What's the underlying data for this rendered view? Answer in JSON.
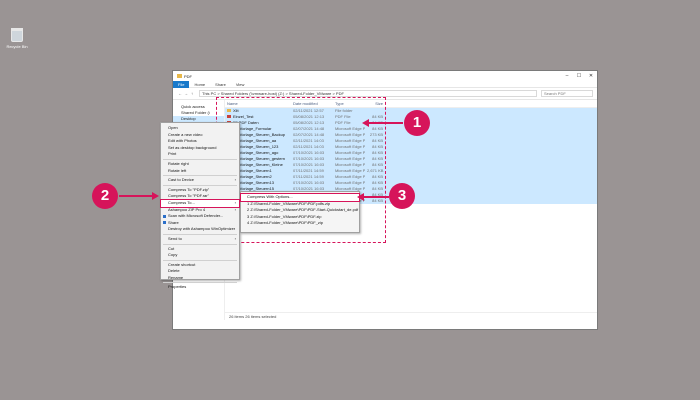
{
  "desktop": {
    "recycle_bin_label": "Recycle Bin"
  },
  "window": {
    "title": "PDF",
    "ribbon_tabs": [
      "File",
      "Home",
      "Share",
      "View"
    ],
    "address_path": "This PC  >  Shared Folders (\\\\vmware-host) (Z:)  >  Shared-Folder_VMware  >  PDF",
    "search_placeholder": "Search PDF",
    "nav_items": [
      "Quick access",
      "Shared Folder (\\",
      "Desktop"
    ],
    "columns": {
      "name": "Name",
      "date": "Date modified",
      "type": "Type",
      "size": "Size"
    },
    "files": [
      {
        "name": "Xlit",
        "date": "02/11/2021 12:57",
        "type": "File folder",
        "size": ""
      },
      {
        "name": "Einzel_Test",
        "date": "05/08/2021 12:13",
        "type": "PDF File",
        "size": "84 KB"
      },
      {
        "name": "5F PDF Daten",
        "date": "05/08/2021 12:13",
        "type": "PDF File",
        "size": "84 KB"
      },
      {
        "name": "CV-Vorlage_Formular",
        "date": "02/07/2021 14:48",
        "type": "Microsoft Edge P...",
        "size": "84 KB"
      },
      {
        "name": "CV-Vorlage_Steuern_Backup",
        "date": "02/07/2021 14:48",
        "type": "Microsoft Edge P...",
        "size": "273 KB"
      },
      {
        "name": "CV-Vorlage_Steuern_aa",
        "date": "02/11/2021 14:03",
        "type": "Microsoft Edge P...",
        "size": "84 KB"
      },
      {
        "name": "CV-Vorlage_Steuern_123",
        "date": "02/11/2021 14:03",
        "type": "Microsoft Edge P...",
        "size": "84 KB"
      },
      {
        "name": "CV-Vorlage_Steuern_ago",
        "date": "07/10/2021 16:03",
        "type": "Microsoft Edge P...",
        "size": "84 KB"
      },
      {
        "name": "CV-Vorlage_Steuern_gestern",
        "date": "07/10/2021 16:03",
        "type": "Microsoft Edge P...",
        "size": "84 KB"
      },
      {
        "name": "CV-Vorlage_Steuern_Kleine",
        "date": "07/10/2021 16:03",
        "type": "Microsoft Edge P...",
        "size": "84 KB"
      },
      {
        "name": "CV-Vorlage_Steuern1",
        "date": "07/11/2021 14:59",
        "type": "Microsoft Edge P...",
        "size": "2,671 KB"
      },
      {
        "name": "CV-Vorlage_Steuern2",
        "date": "07/11/2021 14:59",
        "type": "Microsoft Edge P...",
        "size": "84 KB"
      },
      {
        "name": "CV-Vorlage_Steuern13",
        "date": "07/10/2021 16:03",
        "type": "Microsoft Edge P...",
        "size": "84 KB"
      },
      {
        "name": "CV-Vorlage_Steuern15",
        "date": "07/10/2021 16:03",
        "type": "Microsoft Edge P...",
        "size": "84 KB"
      },
      {
        "name": "Kfz_Mess.zip",
        "date": "03/11/2021 12:00",
        "type": "ZIP File",
        "size": "84 KB"
      },
      {
        "name": "Microsoft Edge",
        "date": "07/10/2021 16:03",
        "type": "Microsoft Edge P...",
        "size": "84 KB"
      }
    ],
    "status": "26 items    26 items selected"
  },
  "context_menu": {
    "items": [
      {
        "label": "Open",
        "arrow": false,
        "sep_after": false
      },
      {
        "label": "Create a new video",
        "arrow": false,
        "sep_after": false
      },
      {
        "label": "Edit with Photos",
        "arrow": false,
        "sep_after": false
      },
      {
        "label": "Set as desktop background",
        "arrow": false,
        "sep_after": false
      },
      {
        "label": "Print",
        "arrow": false,
        "sep_after": true
      },
      {
        "label": "Rotate right",
        "arrow": false,
        "sep_after": false
      },
      {
        "label": "Rotate left",
        "arrow": false,
        "sep_after": true
      },
      {
        "label": "Cast to Device",
        "arrow": true,
        "sep_after": true
      },
      {
        "label": "Compress To \"PDF.zip\"",
        "arrow": false,
        "sep_after": false
      },
      {
        "label": "Compress To \"PDF.rar\"",
        "arrow": false,
        "sep_after": false
      },
      {
        "label": "Compress To...",
        "arrow": true,
        "sep_after": false,
        "highlight": true
      },
      {
        "label": "Ashampoo ZIP Pro 4",
        "arrow": true,
        "sep_after": false
      },
      {
        "label": "Scan with Microsoft Defender...",
        "arrow": false,
        "sep_after": false,
        "icon": true
      },
      {
        "label": "Share",
        "arrow": false,
        "sep_after": false,
        "icon": true
      },
      {
        "label": "Destroy with Ashampoo WinOptimizer",
        "arrow": false,
        "sep_after": true
      },
      {
        "label": "Send to",
        "arrow": true,
        "sep_after": true
      },
      {
        "label": "Cut",
        "arrow": false,
        "sep_after": false
      },
      {
        "label": "Copy",
        "arrow": false,
        "sep_after": true
      },
      {
        "label": "Create shortcut",
        "arrow": false,
        "sep_after": false
      },
      {
        "label": "Delete",
        "arrow": false,
        "sep_after": false
      },
      {
        "label": "Rename",
        "arrow": false,
        "sep_after": true
      },
      {
        "label": "Properties",
        "arrow": false,
        "sep_after": false
      }
    ]
  },
  "submenu": {
    "items": [
      {
        "label": "Compress With Options...",
        "highlight": true
      },
      {
        "label": "1 Z:\\Shared-Folder_VMware\\PDF\\PDF.pdfs.zip",
        "highlight": false
      },
      {
        "label": "2 Z:\\Shared-Folder_VMware\\PDF\\PDF-Start-Quickstart_de.pdf",
        "highlight": false
      },
      {
        "label": "3 Z:\\Shared-Folder_VMware\\PDF\\PDF.zip",
        "highlight": false
      },
      {
        "label": "4 Z:\\Shared-Folder_VMware\\PDF\\PDF_zip",
        "highlight": false
      }
    ]
  },
  "annotations": {
    "step1": "1",
    "step2": "2",
    "step3": "3",
    "accent_color": "#d6145a"
  },
  "colors": {
    "desktop_bg": "#9a9494",
    "selection": "#cce8ff",
    "file_tab": "#1979ca"
  }
}
